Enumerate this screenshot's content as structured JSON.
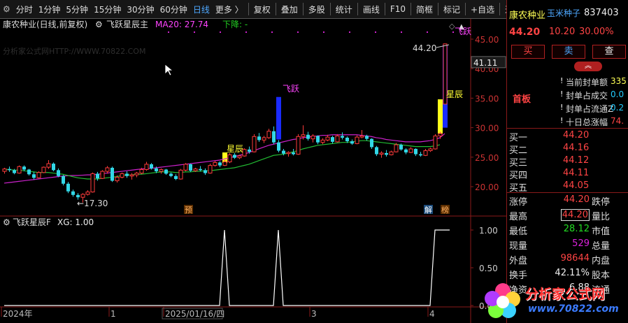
{
  "toolbar": {
    "periods": [
      "分时",
      "1分钟",
      "5分钟",
      "15分钟",
      "30分钟",
      "60分钟",
      "日线",
      "更多 〉"
    ],
    "tools": [
      "复权",
      "叠加",
      "多股",
      "统计",
      "画线",
      "F10",
      "简框",
      "标记",
      "+自选",
      "返回"
    ]
  },
  "main_chart": {
    "title": "康农种业(日线,前复权)",
    "indicator": "飞跃星辰主",
    "ma_label": "MA20: 27.74",
    "trend_label": "下降: -",
    "watermark": "分析家公式网HTTP://WWW.70822.COM",
    "y_ticks": [
      "45.00",
      "40.00",
      "35.00",
      "30.00",
      "25.00",
      "20.00"
    ],
    "current_price_tag": "41.11",
    "high_annotation": "44.20",
    "low_annotation": "17.30",
    "annotations": [
      "飞跃",
      "星辰",
      "星辰",
      "预",
      "解",
      "榜"
    ]
  },
  "sub_chart": {
    "title": "飞跃星辰F",
    "xg_label": "XG: 1.00",
    "y_ticks": [
      "1.00",
      "0.50",
      "0.00"
    ]
  },
  "x_axis": {
    "labels": [
      "2024年",
      "1",
      "2025/01/16/四",
      "3",
      "4"
    ]
  },
  "stock": {
    "name": "康农种业",
    "concept": "玉米种子",
    "code": "837403",
    "price": "44.20",
    "change": "10.20",
    "change_pct": "30.00%",
    "buttons": [
      "买",
      "卖",
      "查"
    ],
    "board_label": "首板",
    "seal_info": [
      {
        "label": "当前封单额",
        "value": "335"
      },
      {
        "label": "封单占成交",
        "value": "0.0"
      },
      {
        "label": "封单占流通Z",
        "value": "0.2"
      },
      {
        "label": "十日总涨幅",
        "value": "74."
      }
    ],
    "bids": [
      {
        "label": "买一",
        "price": "44.20"
      },
      {
        "label": "买二",
        "price": "44.16"
      },
      {
        "label": "买三",
        "price": "44.12"
      },
      {
        "label": "买四",
        "price": "44.11"
      },
      {
        "label": "买五",
        "price": "44.05"
      }
    ],
    "stats": [
      {
        "label": "涨停",
        "value": "44.20",
        "label2": "跌停"
      },
      {
        "label": "最高",
        "value": "44.20",
        "label2": "量比"
      },
      {
        "label": "最低",
        "value": "28.12",
        "label2": "市值"
      },
      {
        "label": "现量",
        "value": "529",
        "label2": "总量"
      },
      {
        "label": "外盘",
        "value": "98644",
        "label2": "内盘"
      },
      {
        "label": "换手",
        "value": "42.11%",
        "label2": "股本"
      },
      {
        "label": "净资",
        "value": "6.88",
        "label2": "流通"
      }
    ],
    "logo_text": "分析家公式网",
    "logo_url": "www.70822.com"
  },
  "chart_data": {
    "type": "candlestick",
    "ohlc": [
      [
        22.6,
        23.2,
        22.2,
        23.0
      ],
      [
        23.0,
        23.4,
        22.5,
        22.8
      ],
      [
        22.8,
        23.0,
        22.1,
        22.3
      ],
      [
        22.3,
        23.6,
        22.2,
        23.4
      ],
      [
        23.4,
        23.6,
        22.6,
        22.9
      ],
      [
        22.9,
        23.0,
        21.9,
        22.1
      ],
      [
        22.1,
        22.5,
        21.2,
        21.5
      ],
      [
        21.5,
        22.6,
        21.4,
        22.4
      ],
      [
        22.4,
        23.4,
        22.3,
        23.3
      ],
      [
        23.3,
        24.5,
        23.0,
        23.9
      ],
      [
        23.9,
        24.1,
        22.6,
        22.8
      ],
      [
        22.8,
        23.1,
        21.6,
        21.8
      ],
      [
        21.8,
        22.0,
        20.2,
        20.5
      ],
      [
        20.5,
        20.8,
        18.9,
        19.2
      ],
      [
        19.2,
        19.5,
        18.3,
        18.6
      ],
      [
        18.6,
        18.9,
        17.8,
        18.2
      ],
      [
        18.2,
        18.9,
        17.3,
        18.7
      ],
      [
        18.7,
        19.4,
        18.5,
        19.1
      ],
      [
        19.1,
        22.4,
        19.0,
        22.2
      ],
      [
        22.2,
        22.5,
        21.0,
        21.4
      ],
      [
        21.4,
        22.8,
        21.3,
        22.6
      ],
      [
        22.6,
        23.5,
        22.2,
        23.2
      ],
      [
        23.2,
        23.4,
        20.8,
        21.0
      ],
      [
        21.0,
        21.9,
        20.7,
        21.6
      ],
      [
        21.6,
        22.4,
        21.4,
        22.2
      ],
      [
        22.2,
        22.6,
        21.5,
        21.8
      ],
      [
        21.8,
        22.3,
        21.2,
        22.0
      ],
      [
        22.0,
        22.5,
        21.6,
        22.3
      ],
      [
        22.3,
        23.2,
        22.1,
        22.9
      ],
      [
        22.9,
        24.2,
        22.7,
        23.8
      ],
      [
        23.8,
        24.0,
        22.9,
        23.1
      ],
      [
        23.1,
        23.4,
        22.3,
        22.6
      ],
      [
        22.6,
        23.1,
        22.2,
        22.9
      ],
      [
        22.9,
        23.0,
        22.0,
        22.2
      ],
      [
        22.2,
        22.4,
        21.6,
        21.8
      ],
      [
        21.8,
        22.1,
        21.1,
        21.3
      ],
      [
        21.3,
        23.0,
        21.2,
        22.8
      ],
      [
        22.8,
        24.0,
        22.6,
        23.8
      ],
      [
        23.8,
        23.9,
        22.5,
        22.7
      ],
      [
        22.7,
        23.2,
        22.5,
        23.0
      ],
      [
        23.0,
        23.5,
        22.6,
        22.8
      ],
      [
        22.8,
        23.1,
        22.0,
        22.3
      ],
      [
        22.3,
        23.9,
        22.2,
        23.6
      ],
      [
        23.6,
        24.4,
        23.4,
        24.1
      ],
      [
        24.1,
        24.3,
        23.3,
        23.6
      ],
      [
        23.6,
        24.5,
        23.5,
        24.2
      ],
      [
        24.2,
        25.7,
        24.0,
        25.4
      ],
      [
        25.4,
        25.7,
        24.7,
        24.9
      ],
      [
        24.9,
        25.4,
        24.7,
        25.2
      ],
      [
        25.2,
        26.5,
        25.1,
        26.3
      ],
      [
        26.3,
        26.8,
        25.6,
        25.9
      ],
      [
        25.9,
        28.9,
        25.8,
        28.5
      ],
      [
        28.5,
        29.1,
        27.6,
        27.9
      ],
      [
        27.9,
        28.6,
        27.4,
        28.3
      ],
      [
        28.3,
        29.8,
        28.1,
        29.4
      ],
      [
        29.4,
        30.2,
        27.2,
        27.5
      ],
      [
        27.5,
        27.9,
        25.8,
        26.1
      ],
      [
        26.1,
        26.4,
        25.3,
        25.6
      ],
      [
        25.6,
        26.0,
        25.1,
        25.8
      ],
      [
        25.8,
        26.4,
        25.3,
        25.5
      ],
      [
        25.5,
        28.9,
        25.4,
        28.5
      ],
      [
        28.5,
        30.4,
        28.0,
        28.8
      ],
      [
        28.8,
        29.3,
        27.8,
        28.1
      ],
      [
        28.1,
        28.9,
        27.5,
        28.6
      ],
      [
        28.6,
        28.7,
        27.2,
        27.5
      ],
      [
        27.5,
        28.2,
        27.2,
        27.9
      ],
      [
        27.9,
        28.8,
        27.7,
        28.4
      ],
      [
        28.4,
        28.6,
        27.3,
        27.6
      ],
      [
        27.6,
        28.9,
        27.5,
        28.6
      ],
      [
        28.6,
        29.2,
        28.0,
        28.3
      ],
      [
        28.3,
        28.5,
        27.4,
        27.7
      ],
      [
        27.7,
        28.0,
        27.1,
        27.3
      ],
      [
        27.3,
        28.7,
        27.2,
        28.4
      ],
      [
        28.4,
        29.6,
        28.2,
        28.6
      ],
      [
        28.6,
        28.8,
        27.8,
        28.1
      ],
      [
        28.1,
        28.2,
        26.4,
        26.7
      ],
      [
        26.7,
        26.9,
        25.2,
        25.5
      ],
      [
        25.5,
        26.0,
        24.9,
        25.7
      ],
      [
        25.7,
        26.2,
        25.1,
        25.4
      ],
      [
        25.4,
        26.1,
        25.3,
        25.9
      ],
      [
        25.9,
        27.4,
        25.8,
        27.1
      ],
      [
        27.1,
        27.3,
        26.1,
        26.3
      ],
      [
        26.3,
        26.5,
        25.5,
        25.8
      ],
      [
        25.8,
        26.7,
        25.7,
        26.4
      ],
      [
        26.4,
        26.5,
        25.2,
        25.5
      ],
      [
        25.5,
        25.9,
        25.1,
        25.3
      ],
      [
        25.3,
        26.4,
        25.2,
        26.1
      ],
      [
        26.1,
        26.6,
        25.9,
        26.4
      ],
      [
        26.4,
        28.9,
        26.3,
        28.6
      ],
      [
        28.6,
        29.3,
        28.1,
        29.0
      ],
      [
        34.0,
        44.2,
        34.0,
        44.2
      ]
    ],
    "ma20": [
      22.9,
      22.9,
      22.8,
      22.8,
      22.7,
      22.6,
      22.5,
      22.4,
      22.4,
      22.4,
      22.3,
      22.2,
      22.1,
      21.9,
      21.7,
      21.5,
      21.4,
      21.3,
      21.3,
      21.3,
      21.4,
      21.5,
      21.6,
      21.7,
      21.9,
      22.0,
      22.0,
      22.1,
      22.1,
      22.2,
      22.3,
      22.4,
      22.5,
      22.5,
      22.5,
      22.4,
      22.4,
      22.5,
      22.5,
      22.6,
      22.6,
      22.7,
      22.7,
      22.8,
      22.9,
      23.0,
      23.1,
      23.2,
      23.4,
      23.6,
      23.8,
      24.1,
      24.4,
      24.7,
      25.0,
      25.3,
      25.4,
      25.5,
      25.7,
      25.9,
      26.1,
      26.4,
      26.6,
      26.8,
      27.0,
      27.1,
      27.2,
      27.3,
      27.4,
      27.5,
      27.5,
      27.6,
      27.7,
      27.8,
      27.8,
      27.7,
      27.6,
      27.5,
      27.4,
      27.3,
      27.2,
      27.1,
      27.0,
      26.9,
      26.8,
      26.8,
      26.8,
      26.8,
      26.9,
      27.1,
      27.74
    ],
    "line2": [
      20.6,
      20.7,
      20.8,
      20.9,
      21.0,
      21.1,
      21.2,
      21.3,
      21.4,
      21.5,
      21.6,
      21.7,
      21.8,
      21.85,
      21.9,
      21.9,
      21.95,
      22.0,
      22.0,
      22.1,
      22.2,
      22.3,
      22.4,
      22.5,
      22.6,
      22.7,
      22.8,
      22.9,
      23.0,
      23.05,
      23.1,
      23.2,
      23.3,
      23.4,
      23.5,
      23.6,
      23.7,
      23.8,
      23.9,
      24.0,
      24.1,
      24.2,
      24.3,
      24.4,
      24.5,
      24.7,
      24.9,
      25.1,
      25.3,
      25.5,
      25.8,
      26.1,
      26.4,
      26.7,
      27.0,
      27.2,
      27.4,
      27.6,
      27.8,
      28.0,
      28.1,
      28.3,
      28.4,
      28.5,
      28.6,
      28.7,
      28.7,
      28.8,
      28.8,
      28.8,
      28.8,
      28.8,
      28.8,
      28.7,
      28.6,
      28.5,
      28.3,
      28.2,
      28.0,
      27.9,
      27.8,
      27.7,
      27.6,
      27.6,
      27.6,
      27.6,
      27.7,
      27.8,
      28.0,
      28.3,
      29.0
    ],
    "signal_bars": [
      {
        "type": "飞跃",
        "index": 56,
        "from": 28.0,
        "to": 35.2
      },
      {
        "type": "星辰",
        "index": 45,
        "from": 24.0,
        "to": 25.8
      },
      {
        "type": "星辰",
        "index": 89,
        "from": 29.0,
        "to": 34.8
      },
      {
        "type": "飞跃",
        "index": 90,
        "from": 30.0,
        "to": 44.0
      }
    ],
    "xg": [
      {
        "i": 0,
        "v": 0
      },
      {
        "i": 44,
        "v": 0
      },
      {
        "i": 45,
        "v": 1
      },
      {
        "i": 46,
        "v": 0
      },
      {
        "i": 55,
        "v": 0
      },
      {
        "i": 56,
        "v": 1
      },
      {
        "i": 57,
        "v": 0
      },
      {
        "i": 87,
        "v": 0
      },
      {
        "i": 88,
        "v": 1
      },
      {
        "i": 90,
        "v": 1
      }
    ],
    "ylim": [
      17.0,
      46.0
    ],
    "colors": {
      "up": "#ff3b3b",
      "down": "#32d7e6",
      "ma20": "#22bb33",
      "line2": "#cc22cc",
      "feiyue": "#1a2bff",
      "xingchen": "#ffff1a"
    }
  }
}
